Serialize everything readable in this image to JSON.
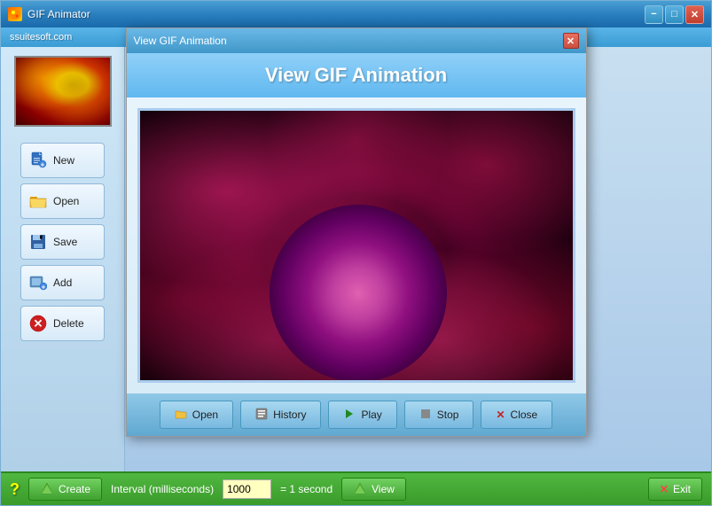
{
  "app": {
    "title": "GIF Animator",
    "brand": "ssuitesoft.com"
  },
  "titlebar": {
    "minimize_label": "−",
    "maximize_label": "□",
    "close_label": "✕"
  },
  "sidebar": {
    "buttons": [
      {
        "id": "new",
        "label": "New",
        "icon": "📄"
      },
      {
        "id": "open",
        "label": "Open",
        "icon": "📂"
      },
      {
        "id": "save",
        "label": "Save",
        "icon": "💾"
      },
      {
        "id": "add",
        "label": "Add",
        "icon": "🖼"
      },
      {
        "id": "delete",
        "label": "Delete",
        "icon": "❌"
      }
    ]
  },
  "modal": {
    "title": "View GIF Animation",
    "header": "View GIF Animation",
    "buttons": [
      {
        "id": "open",
        "label": "Open",
        "icon": "📂"
      },
      {
        "id": "history",
        "label": "History",
        "icon": "📋"
      },
      {
        "id": "play",
        "label": "Play",
        "icon": "▶"
      },
      {
        "id": "stop",
        "label": "Stop",
        "icon": "■"
      },
      {
        "id": "close",
        "label": "Close",
        "icon": "✕"
      }
    ],
    "close_btn": "✕"
  },
  "statusbar": {
    "help_label": "?",
    "create_label": "Create",
    "interval_label": "Interval (milliseconds)",
    "interval_value": "1000",
    "equals_label": "= 1 second",
    "view_label": "View",
    "exit_label": "Exit",
    "exit_icon": "✕"
  }
}
